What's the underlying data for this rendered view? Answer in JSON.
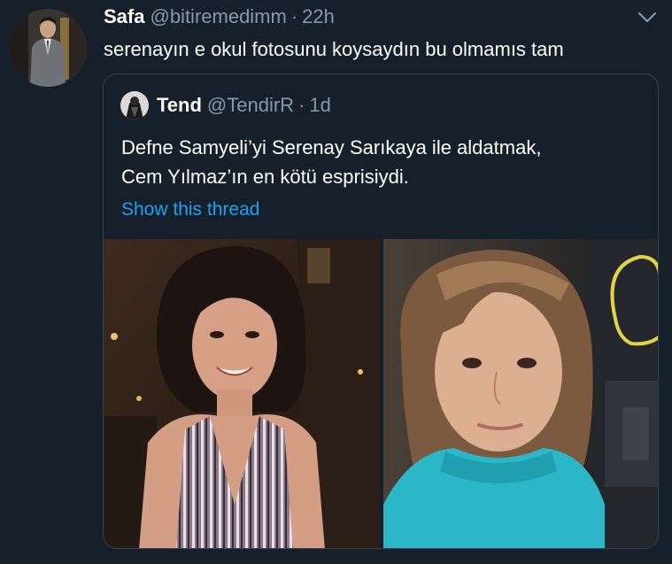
{
  "tweet": {
    "display_name": "Safa",
    "handle": "@bitiremedimm",
    "separator": "·",
    "time": "22h",
    "text": "serenayın e okul fotosunu koysaydın bu olmamıs tam",
    "avatar_icon": "profile-photo",
    "menu_icon": "chevron-down-icon"
  },
  "quoted_tweet": {
    "display_name": "Tend",
    "handle": "@TendirR",
    "separator": "·",
    "time": "1d",
    "text_lines": [
      "Defne Samyeli’yi Serenay Sarıkaya ile aldatmak,",
      "Cem Yılmaz’ın en kötü esprisiydi."
    ],
    "show_thread_label": "Show this thread",
    "photos": [
      "photo-woman-sequin-dress",
      "photo-woman-turtleneck"
    ]
  },
  "colors": {
    "background": "#15202b",
    "text_primary": "#ffffff",
    "text_secondary": "#8899a6",
    "link": "#1da1f2",
    "border": "#38444d"
  }
}
